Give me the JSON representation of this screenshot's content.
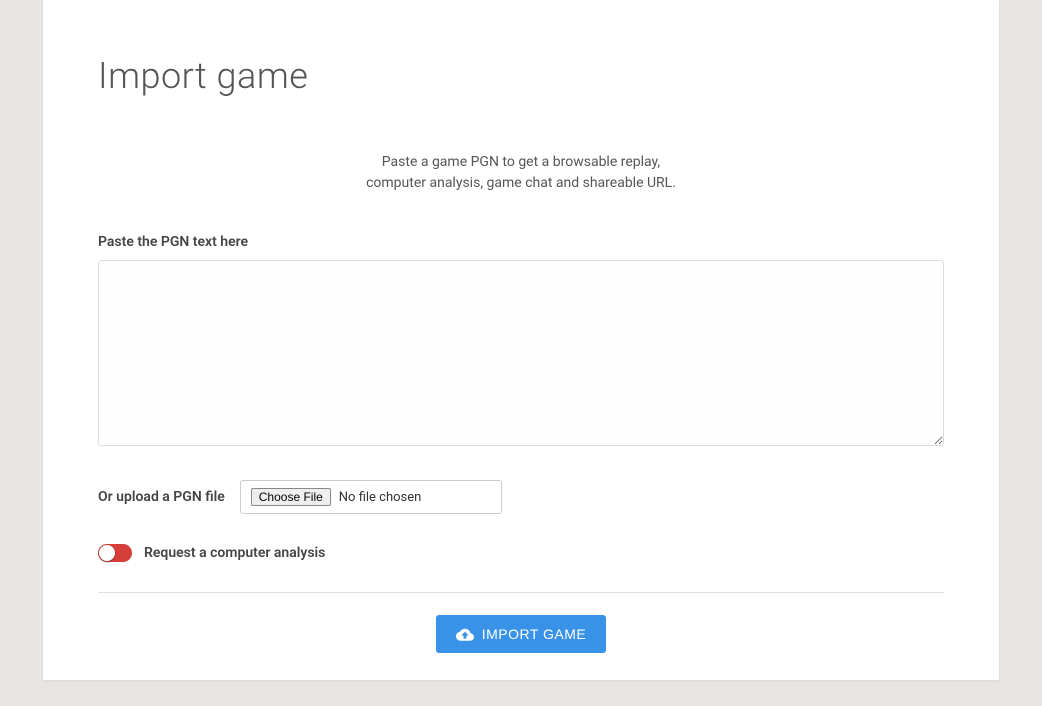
{
  "page": {
    "title": "Import game"
  },
  "description": {
    "line1": "Paste a game PGN to get a browsable replay,",
    "line2": "computer analysis, game chat and shareable URL."
  },
  "form": {
    "pgn_label": "Paste the PGN text here",
    "pgn_value": "",
    "upload_label": "Or upload a PGN file",
    "file_button_label": "Choose File",
    "file_status": "No file chosen",
    "analysis_label": "Request a computer analysis",
    "submit_label": "IMPORT GAME"
  }
}
